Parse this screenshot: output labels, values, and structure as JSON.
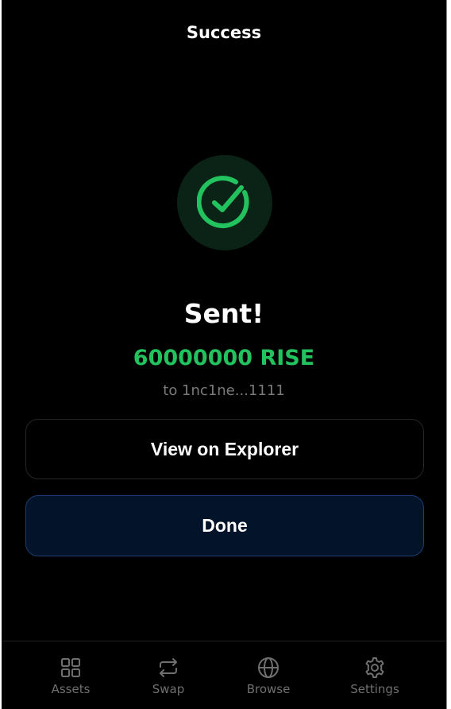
{
  "header": {
    "title": "Success"
  },
  "status": {
    "icon": "check-circle-icon",
    "heading": "Sent!",
    "amount": "60000000 RISE",
    "recipient": "to 1nc1ne...1111"
  },
  "actions": {
    "explorer_label": "View on Explorer",
    "done_label": "Done"
  },
  "nav": {
    "items": [
      {
        "label": "Assets",
        "icon": "grid-icon"
      },
      {
        "label": "Swap",
        "icon": "swap-arrows-icon"
      },
      {
        "label": "Browse",
        "icon": "globe-icon"
      },
      {
        "label": "Settings",
        "icon": "gear-icon"
      }
    ]
  },
  "colors": {
    "background": "#000000",
    "success_green": "#22c35e",
    "done_button_bg": "#031329",
    "done_button_border": "#1b3d72",
    "muted_text": "#7a7a7a"
  }
}
